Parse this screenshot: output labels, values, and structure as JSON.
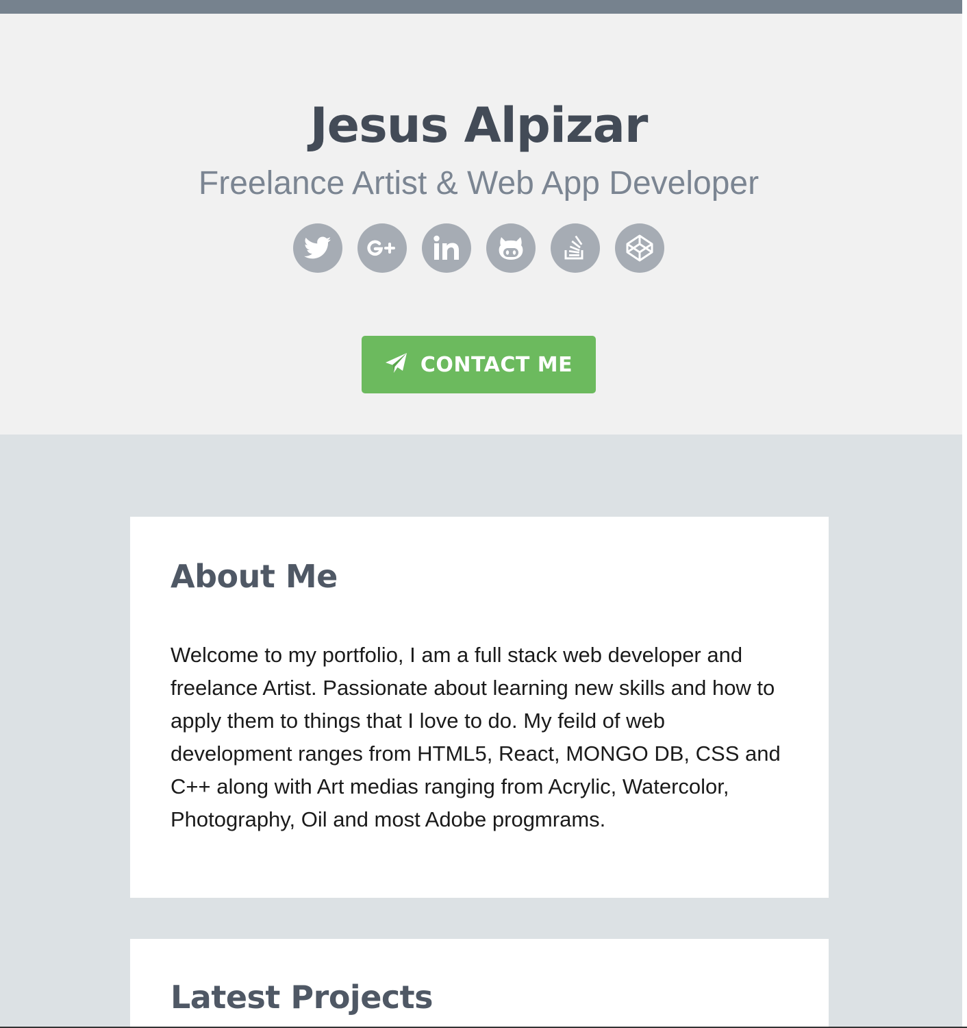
{
  "hero": {
    "name": "Jesus Alpizar",
    "tagline": "Freelance Artist & Web App Developer",
    "social": [
      {
        "icon": "twitter-icon"
      },
      {
        "icon": "google-plus-icon"
      },
      {
        "icon": "linkedin-icon"
      },
      {
        "icon": "github-icon"
      },
      {
        "icon": "stack-overflow-icon"
      },
      {
        "icon": "codepen-icon"
      }
    ],
    "contact_label": "CONTACT ME"
  },
  "about": {
    "title": "About Me",
    "text": "Welcome to my portfolio, I am a full stack web developer and freelance Artist. Passionate about learning new skills and how to apply them to things that I love to do. My feild of web development ranges from HTML5, React, MONGO DB, CSS and C++ along with Art medias ranging from Acrylic, Watercolor, Photography, Oil and most Adobe progmrams."
  },
  "projects": {
    "title": "Latest Projects"
  },
  "colors": {
    "accent": "#6cba5e",
    "heading": "#434b57",
    "subtle": "#7b8592",
    "icon_bg": "#a6acb4",
    "page_bg": "#dce1e4",
    "hero_bg": "#f1f1f1",
    "top_bar": "#76828e"
  }
}
